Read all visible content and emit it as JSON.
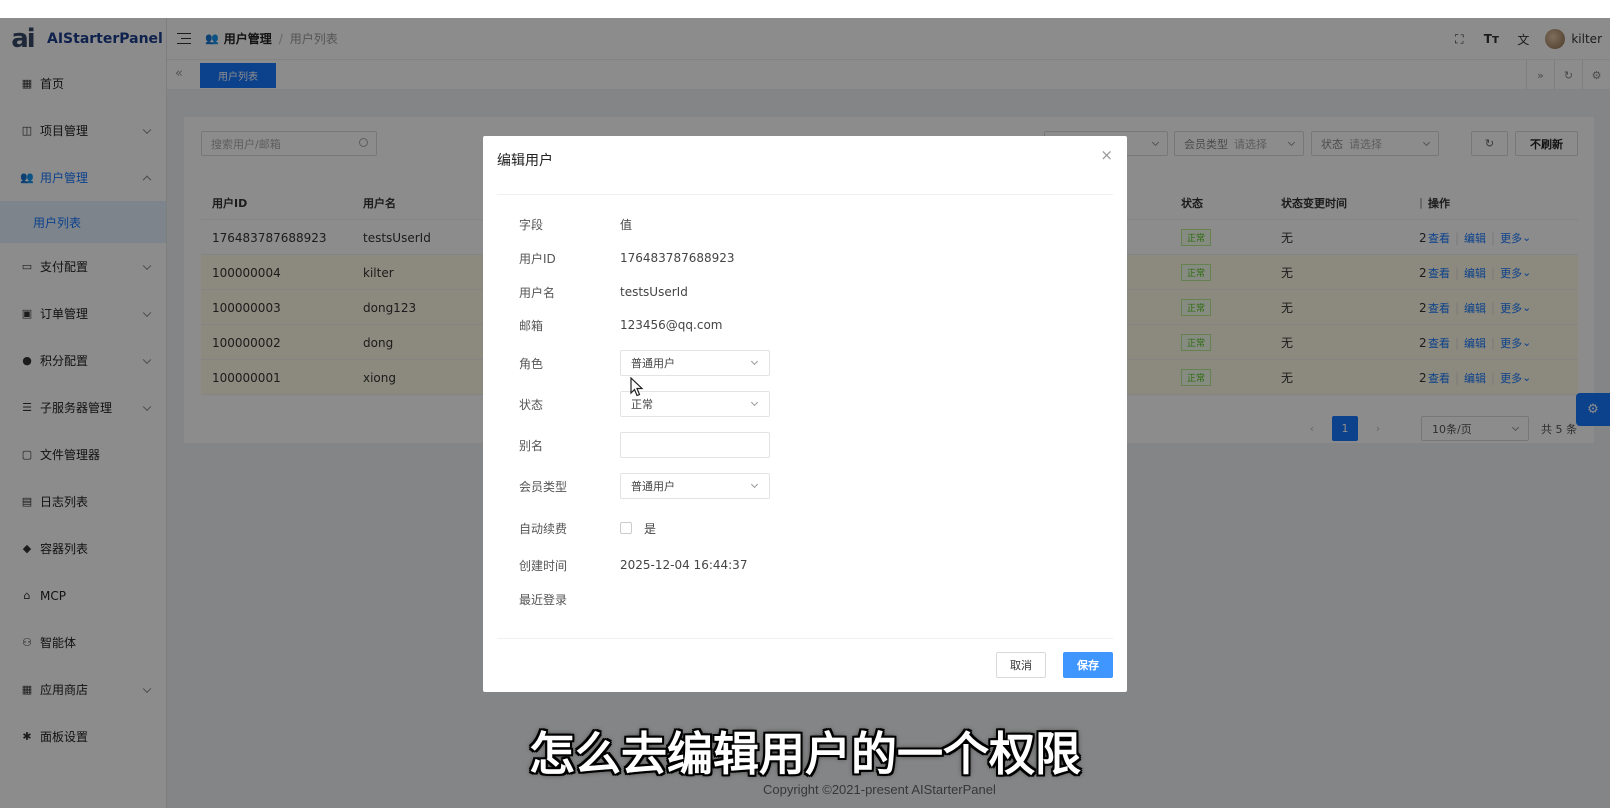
{
  "app": {
    "logo_mark": "ai",
    "logo_text": "AIStarterPanel"
  },
  "sidebar": {
    "items": [
      {
        "label": "首页",
        "icon": "dashboard-icon",
        "glyph": "▦"
      },
      {
        "label": "项目管理",
        "icon": "project-icon",
        "glyph": "◫",
        "expandable": true
      },
      {
        "label": "用户管理",
        "icon": "users-icon",
        "glyph": "👥",
        "expandable": true,
        "expanded": true,
        "active": true
      },
      {
        "label": "支付配置",
        "icon": "payment-icon",
        "glyph": "▭",
        "expandable": true
      },
      {
        "label": "订单管理",
        "icon": "order-icon",
        "glyph": "▣",
        "expandable": true
      },
      {
        "label": "积分配置",
        "icon": "points-icon",
        "glyph": "●",
        "expandable": true
      },
      {
        "label": "子服务器管理",
        "icon": "server-icon",
        "glyph": "☰",
        "expandable": true
      },
      {
        "label": "文件管理器",
        "icon": "folder-icon",
        "glyph": "▢"
      },
      {
        "label": "日志列表",
        "icon": "log-icon",
        "glyph": "▤"
      },
      {
        "label": "容器列表",
        "icon": "container-icon",
        "glyph": "◆"
      },
      {
        "label": "MCP",
        "icon": "mcp-icon",
        "glyph": "⌂"
      },
      {
        "label": "智能体",
        "icon": "agent-icon",
        "glyph": "⚇"
      },
      {
        "label": "应用商店",
        "icon": "appstore-icon",
        "glyph": "▦",
        "expandable": true
      },
      {
        "label": "面板设置",
        "icon": "settings-icon",
        "glyph": "✱"
      }
    ],
    "sub_active": "用户列表"
  },
  "topbar": {
    "breadcrumb_1": "用户管理",
    "breadcrumb_sep": "/",
    "breadcrumb_2": "用户列表",
    "username": "kilter"
  },
  "tabs": {
    "active": "用户列表"
  },
  "filters": {
    "search_placeholder": "搜索用户/邮箱",
    "member_label": "会员类型",
    "member_value": "请选择",
    "status_label": "状态",
    "status_value": "请选择",
    "norefresh": "不刷新"
  },
  "table": {
    "headers": [
      "用户ID",
      "用户名",
      "状态",
      "状态变更时间",
      "操作"
    ],
    "rows": [
      {
        "id": "176483787688923",
        "name": "testsUserId",
        "status": "正常",
        "changed": "无",
        "highlight": false
      },
      {
        "id": "100000004",
        "name": "kilter",
        "status": "正常",
        "changed": "无",
        "highlight": true
      },
      {
        "id": "100000003",
        "name": "dong123",
        "status": "正常",
        "changed": "无",
        "highlight": true
      },
      {
        "id": "100000002",
        "name": "dong",
        "status": "正常",
        "changed": "无",
        "highlight": true
      },
      {
        "id": "100000001",
        "name": "xiong",
        "status": "正常",
        "changed": "无",
        "highlight": true
      }
    ],
    "op_view": "查看",
    "op_edit": "编辑",
    "op_more": "更多"
  },
  "pager": {
    "current": "1",
    "page_size": "10条/页",
    "total": "共 5 条"
  },
  "modal": {
    "title": "编辑用户",
    "field_header": "字段",
    "value_header": "值",
    "fields": {
      "user_id_label": "用户ID",
      "user_id_value": "176483787688923",
      "username_label": "用户名",
      "username_value": "testsUserId",
      "email_label": "邮箱",
      "email_value": "123456@qq.com",
      "role_label": "角色",
      "role_value": "普通用户",
      "status_label": "状态",
      "status_value": "正常",
      "alias_label": "别名",
      "alias_value": "",
      "member_label": "会员类型",
      "member_value": "普通用户",
      "autorenew_label": "自动续费",
      "autorenew_text": "是",
      "created_label": "创建时间",
      "created_value": "2025-12-04 16:44:37",
      "lastlogin_label": "最近登录"
    },
    "cancel": "取消",
    "save": "保存"
  },
  "subtitle": "怎么去编辑用户的一个权限",
  "copyright": "Copyright ©2021-present AIStarterPanel"
}
